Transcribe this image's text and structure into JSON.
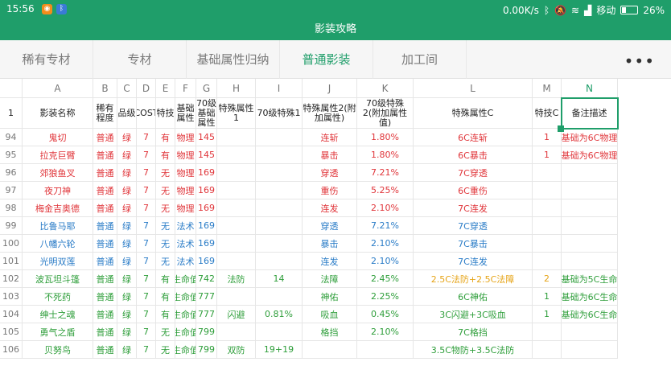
{
  "status_bar": {
    "time": "15:56",
    "network_speed": "0.00K/s",
    "carrier": "移动",
    "battery_percent": "26%",
    "battery_level": 0.26,
    "icons": [
      "notification-app-icon",
      "bluetooth-icon",
      "mute-icon",
      "wifi-icon",
      "signal-icon",
      "battery-icon"
    ]
  },
  "title": "影装攻略",
  "tabs": [
    {
      "label": "稀有专材",
      "active": false
    },
    {
      "label": "专材",
      "active": false
    },
    {
      "label": "基础属性归纳",
      "active": false
    },
    {
      "label": "普通影装",
      "active": true
    },
    {
      "label": "加工间",
      "active": false
    }
  ],
  "more_label": "•••",
  "columns": [
    "A",
    "B",
    "C",
    "D",
    "E",
    "F",
    "G",
    "H",
    "I",
    "J",
    "K",
    "L",
    "M",
    "N"
  ],
  "selected_column": "N",
  "header_row": {
    "row_number": "1",
    "cells": [
      "影装名称",
      "稀有程度",
      "品级",
      "COST",
      "特技",
      "基础属性",
      "70级基础属性",
      "特殊属性1",
      "70级特殊1",
      "特殊属性2(附加属性)",
      "70级特殊2(附加属性值)",
      "特殊属性C",
      "特技C",
      "备注描述"
    ]
  },
  "rows": [
    {
      "num": "94",
      "color": "red",
      "cells": [
        "鬼切",
        "普通",
        "绿",
        "7",
        "有",
        "物理",
        "145",
        "",
        "",
        "连斩",
        "1.80%",
        "6C连斩",
        "1",
        "基础为6C物理"
      ]
    },
    {
      "num": "95",
      "color": "red",
      "cells": [
        "拉克巨臂",
        "普通",
        "绿",
        "7",
        "有",
        "物理",
        "145",
        "",
        "",
        "暴击",
        "1.80%",
        "6C暴击",
        "1",
        "基础为6C物理"
      ]
    },
    {
      "num": "96",
      "color": "red",
      "cells": [
        "郊狼鱼叉",
        "普通",
        "绿",
        "7",
        "无",
        "物理",
        "169",
        "",
        "",
        "穿透",
        "7.21%",
        "7C穿透",
        "",
        ""
      ]
    },
    {
      "num": "97",
      "color": "red",
      "cells": [
        "夜刀神",
        "普通",
        "绿",
        "7",
        "无",
        "物理",
        "169",
        "",
        "",
        "重伤",
        "5.25%",
        "6C重伤",
        "",
        ""
      ]
    },
    {
      "num": "98",
      "color": "red",
      "cells": [
        "梅金吉奥德",
        "普通",
        "绿",
        "7",
        "无",
        "物理",
        "169",
        "",
        "",
        "连发",
        "2.10%",
        "7C连发",
        "",
        ""
      ]
    },
    {
      "num": "99",
      "color": "blue",
      "cells": [
        "比鲁马耶",
        "普通",
        "绿",
        "7",
        "无",
        "法术",
        "169",
        "",
        "",
        "穿透",
        "7.21%",
        "7C穿透",
        "",
        ""
      ]
    },
    {
      "num": "100",
      "color": "blue",
      "cells": [
        "八幡六轮",
        "普通",
        "绿",
        "7",
        "无",
        "法术",
        "169",
        "",
        "",
        "暴击",
        "2.10%",
        "7C暴击",
        "",
        ""
      ]
    },
    {
      "num": "101",
      "color": "blue",
      "cells": [
        "光明双莲",
        "普通",
        "绿",
        "7",
        "无",
        "法术",
        "169",
        "",
        "",
        "连发",
        "2.10%",
        "7C连发",
        "",
        ""
      ]
    },
    {
      "num": "102",
      "color": "green",
      "cells": [
        "波瓦坦斗篷",
        "普通",
        "绿",
        "7",
        "有",
        "生命值",
        "742",
        "法防",
        "14",
        "法障",
        "2.45%",
        "2.5C法防+2.5C法障",
        "2",
        "基础为5C生命"
      ]
    },
    {
      "num": "103",
      "color": "green",
      "cells": [
        "不死药",
        "普通",
        "绿",
        "7",
        "有",
        "生命值",
        "777",
        "",
        "",
        "神佑",
        "2.25%",
        "6C神佑",
        "1",
        "基础为6C生命"
      ]
    },
    {
      "num": "104",
      "color": "green",
      "cells": [
        "绅士之魂",
        "普通",
        "绿",
        "7",
        "有",
        "生命值",
        "777",
        "闪避",
        "0.81%",
        "吸血",
        "0.45%",
        "3C闪避+3C吸血",
        "1",
        "基础为6C生命"
      ]
    },
    {
      "num": "105",
      "color": "green",
      "cells": [
        "勇气之盾",
        "普通",
        "绿",
        "7",
        "无",
        "生命值",
        "799",
        "",
        "",
        "格挡",
        "2.10%",
        "7C格挡",
        "",
        ""
      ]
    },
    {
      "num": "106",
      "color": "green",
      "cells": [
        "贝努鸟",
        "普通",
        "绿",
        "7",
        "无",
        "生命值",
        "799",
        "双防",
        "19+19",
        "",
        "",
        "3.5C物防+3.5C法防",
        "",
        ""
      ]
    }
  ],
  "row_colors": {
    "red": "#e0353a",
    "blue": "#2a7cc7",
    "green": "#2e9e3a",
    "orange": "#e6a417"
  }
}
